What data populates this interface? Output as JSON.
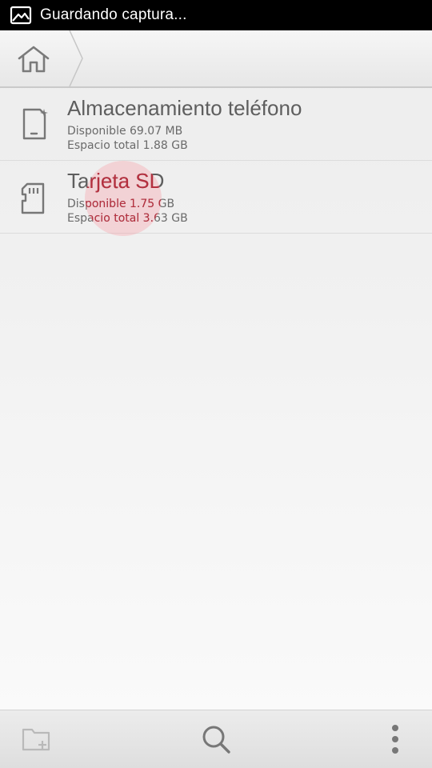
{
  "status_bar": {
    "icon": "image-icon",
    "text": "Guardando captura..."
  },
  "path_bar": {
    "home_icon": "home-icon"
  },
  "storage_items": [
    {
      "icon": "phone-storage-icon",
      "title": "Almacenamiento teléfono",
      "available": "Disponible 69.07 MB",
      "total": "Espacio total 1.88 GB"
    },
    {
      "icon": "sd-card-icon",
      "title": "Tarjeta SD",
      "available": "Disponible 1.75 GB",
      "total": "Espacio total 3.63 GB"
    }
  ],
  "bottom_bar": {
    "new_folder_icon": "new-folder-icon",
    "search_icon": "search-icon",
    "menu_icon": "more-vert-icon"
  },
  "colors": {
    "touch_highlight": "#b5303f",
    "text_primary": "#5e5e5e",
    "text_secondary": "#6a6a6a"
  }
}
